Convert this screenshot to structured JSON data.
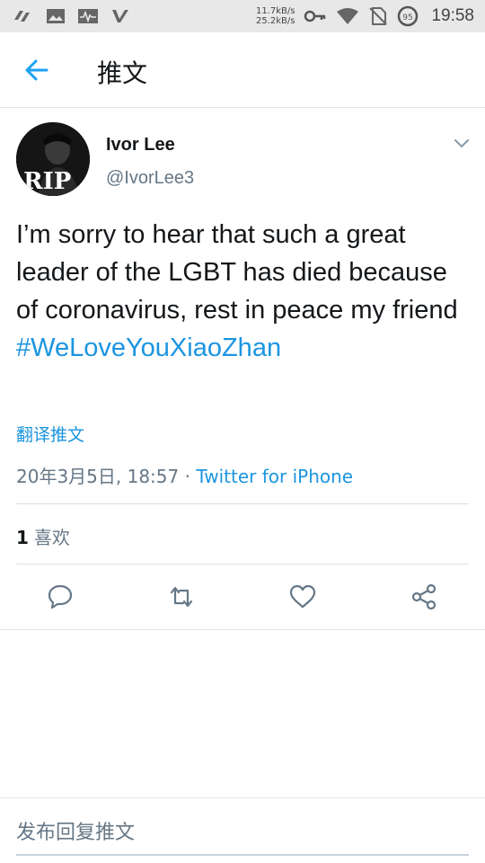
{
  "status_bar": {
    "net_up": "11.7kB/s",
    "net_down": "25.2kB/s",
    "time": "19:58",
    "icons": [
      "signal-icon",
      "image-icon",
      "activity-icon",
      "v-icon",
      "key-icon",
      "wifi-icon",
      "no-sim-icon",
      "battery-icon"
    ]
  },
  "header": {
    "title": "推文",
    "back_icon": "arrow-left-icon",
    "accent": "#1da1f2"
  },
  "tweet": {
    "author_name": "Ivor Lee",
    "author_handle": "@IvorLee3",
    "avatar_text": "RIP",
    "text": "I’m sorry to hear that such a great leader of the LGBT has died because of coronavirus, rest in peace my friend",
    "hashtag": "#WeLoveYouXiaoZhan",
    "translate_label": "翻译推文",
    "timestamp": "20年3月5日, 18:57",
    "separator": " · ",
    "source": "Twitter for iPhone",
    "likes_count": "1",
    "likes_label": "喜欢",
    "link_color": "#1b95e0"
  },
  "actions": [
    "reply-icon",
    "retweet-icon",
    "like-icon",
    "share-icon"
  ],
  "reply_box": {
    "placeholder": "发布回复推文"
  }
}
